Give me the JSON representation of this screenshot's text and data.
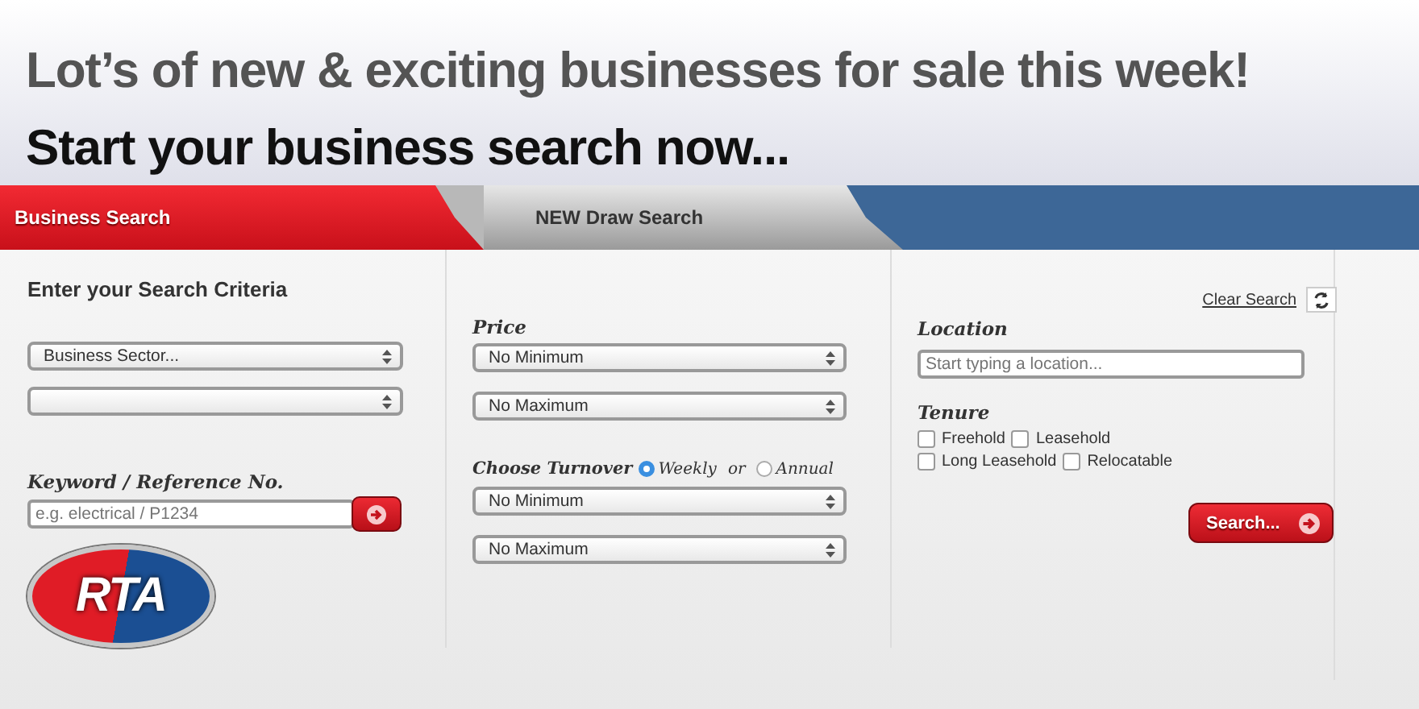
{
  "headline": "Lot’s of new & exciting businesses for sale this week!",
  "subheadline": "Start your business search now...",
  "tabs": [
    {
      "label": "Business Search",
      "selected": true
    },
    {
      "label": "NEW Draw Search",
      "selected": false
    }
  ],
  "form": {
    "title": "Enter your Search Criteria",
    "clear_link": "Clear Search",
    "sector": {
      "value": "Business Sector..."
    },
    "keyword": {
      "label": "Keyword / Reference No.",
      "placeholder": "e.g. electrical / P1234"
    },
    "price": {
      "label": "Price",
      "min": "No Minimum",
      "max": "No Maximum"
    },
    "turnover": {
      "label": "Choose Turnover",
      "separator": "or",
      "options": [
        {
          "label": "Weekly",
          "selected": true
        },
        {
          "label": "Annual",
          "selected": false
        }
      ],
      "min": "No Minimum",
      "max": "No Maximum"
    },
    "location": {
      "label": "Location",
      "placeholder": "Start typing a location..."
    },
    "tenure": {
      "label": "Tenure",
      "options": [
        {
          "label": "Freehold",
          "checked": false
        },
        {
          "label": "Leasehold",
          "checked": false
        },
        {
          "label": "Long Leasehold",
          "checked": false
        },
        {
          "label": "Relocatable",
          "checked": false
        }
      ]
    },
    "search_button": "Search..."
  },
  "logo": "RTA"
}
